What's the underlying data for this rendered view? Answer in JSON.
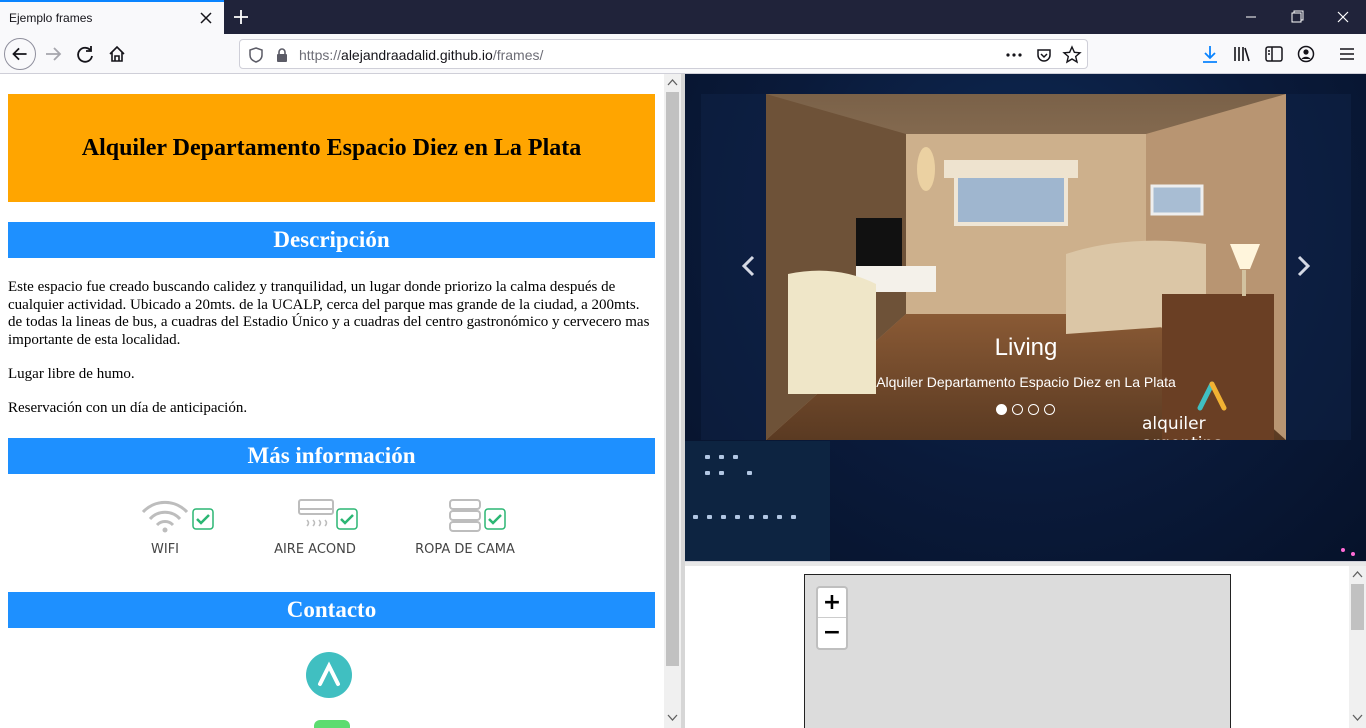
{
  "browser": {
    "tab_title": "Ejemplo frames",
    "url_dim": "https://",
    "url_host": "alejandraadalid.github.io",
    "url_path": "/frames/"
  },
  "left": {
    "title": "Alquiler Departamento Espacio Diez en La Plata",
    "sections": {
      "descripcion": "Descripción",
      "mas_info": "Más información",
      "contacto": "Contacto"
    },
    "paragraphs": [
      "Este espacio fue creado buscando calidez y tranquilidad, un lugar donde priorizo la calma después de cualquier actividad. Ubicado a 20mts. de la UCALP, cerca del parque mas grande de la ciudad, a 200mts. de todas la lineas de bus, a cuadras del Estadio Único y a cuadras del centro gastronómico y cervecero mas importante de esta localidad.",
      "Lugar libre de humo.",
      "Reservación con un día de anticipación."
    ],
    "amenities": [
      {
        "label": "WIFI",
        "icon": "wifi-icon"
      },
      {
        "label": "AIRE ACOND",
        "icon": "air-conditioner-icon"
      },
      {
        "label": "ROPA DE CAMA",
        "icon": "bedding-icon"
      }
    ]
  },
  "slideshow": {
    "caption_title": "Living",
    "caption_sub": "Alquiler Departamento Espacio Diez en La Plata",
    "brand": "alquiler argentina",
    "active_index": 0,
    "slide_count": 4
  },
  "map": {
    "zoom_in": "+",
    "zoom_out": "−"
  },
  "colors": {
    "hero": "#ffa500",
    "section_bar": "#1e90ff",
    "check": "#2bb673"
  }
}
